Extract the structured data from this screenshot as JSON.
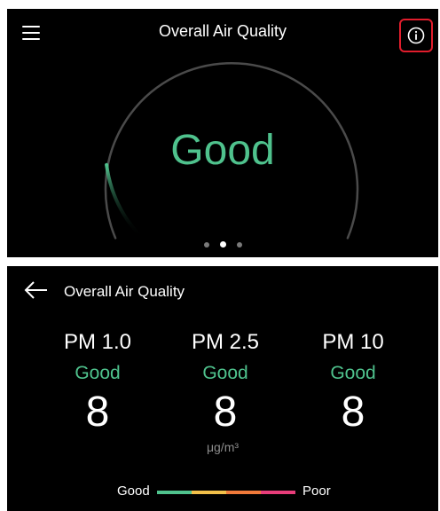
{
  "overview": {
    "title": "Overall Air Quality",
    "status": "Good",
    "status_color": "#4fc28d",
    "gauge_level": 0.14,
    "pager": {
      "count": 3,
      "active": 1
    },
    "icons": {
      "menu": "hamburger-menu-icon",
      "info": "info-icon"
    }
  },
  "detail": {
    "title": "Overall Air Quality",
    "back_icon": "arrow-left-icon",
    "pollutants": [
      {
        "label": "PM 1.0",
        "quality": "Good",
        "value": "8"
      },
      {
        "label": "PM 2.5",
        "quality": "Good",
        "value": "8"
      },
      {
        "label": "PM 10",
        "quality": "Good",
        "value": "8"
      }
    ],
    "unit": "μg/m³",
    "legend": {
      "low_label": "Good",
      "high_label": "Poor",
      "colors": [
        "#4fc28d",
        "#f2c04a",
        "#f07a3a",
        "#e83d7a"
      ]
    }
  }
}
